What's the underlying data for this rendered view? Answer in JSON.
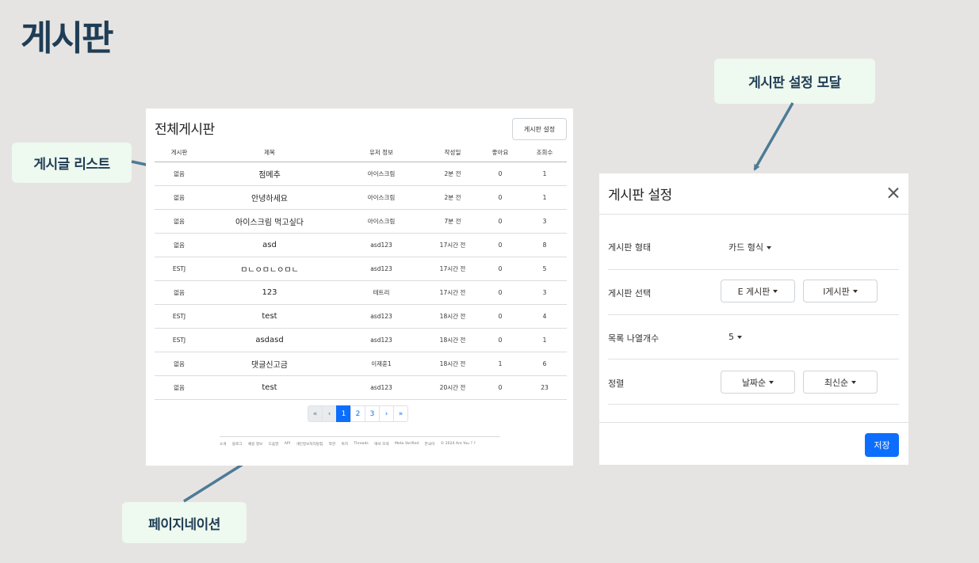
{
  "page_title": "게시판",
  "callouts": {
    "list": "게시글 리스트",
    "modal": "게시판 설정 모달",
    "pagination": "페이지네이션"
  },
  "board": {
    "title": "전체게시판",
    "settings_button": "게시판 설정",
    "columns": [
      "게시판",
      "제목",
      "유저 정보",
      "작성일",
      "좋아요",
      "조회수"
    ],
    "rows": [
      {
        "board": "없음",
        "title": "점메추",
        "user": "아이스크림",
        "date": "2분 전",
        "likes": "0",
        "views": "1"
      },
      {
        "board": "없음",
        "title": "안녕하세요",
        "user": "아이스크림",
        "date": "2분 전",
        "likes": "0",
        "views": "1"
      },
      {
        "board": "없음",
        "title": "아이스크림 먹고싶다",
        "user": "아이스크림",
        "date": "7분 전",
        "likes": "0",
        "views": "3"
      },
      {
        "board": "없음",
        "title": "asd",
        "user": "asd123",
        "date": "17시간 전",
        "likes": "0",
        "views": "8"
      },
      {
        "board": "ESTJ",
        "title": "ㅁㄴㅇㅁㄴㅇㅁㄴ",
        "user": "asd123",
        "date": "17시간 전",
        "likes": "0",
        "views": "5"
      },
      {
        "board": "없음",
        "title": "123",
        "user": "테트리",
        "date": "17시간 전",
        "likes": "0",
        "views": "3"
      },
      {
        "board": "ESTJ",
        "title": "test",
        "user": "asd123",
        "date": "18시간 전",
        "likes": "0",
        "views": "4"
      },
      {
        "board": "ESTJ",
        "title": "asdasd",
        "user": "asd123",
        "date": "18시간 전",
        "likes": "0",
        "views": "1"
      },
      {
        "board": "없음",
        "title": "댓글신고금",
        "user": "이재훈1",
        "date": "18시간 전",
        "likes": "1",
        "views": "6"
      },
      {
        "board": "없음",
        "title": "test",
        "user": "asd123",
        "date": "20시간 전",
        "likes": "0",
        "views": "23"
      }
    ],
    "pagination": {
      "first": "«",
      "prev": "‹",
      "pages": [
        "1",
        "2",
        "3"
      ],
      "next": "›",
      "last": "»",
      "current": "1"
    },
    "footer_links": [
      "소개",
      "블로그",
      "채용 정보",
      "도움말",
      "API",
      "개인정보처리방침",
      "약관",
      "위치",
      "Threads",
      "에서 모색",
      "Meta Verified",
      "한국어",
      "© 2024 Are You ? ?"
    ]
  },
  "modal": {
    "title": "게시판 설정",
    "rows": [
      {
        "label": "게시판 형태",
        "value": "카드 형식"
      },
      {
        "label": "게시판 선택",
        "options": [
          "E 게시판",
          "I게시판"
        ]
      },
      {
        "label": "목록 나열개수",
        "value": "5"
      },
      {
        "label": "정렬",
        "options": [
          "날짜순",
          "최신순"
        ]
      }
    ],
    "save_button": "저장"
  }
}
